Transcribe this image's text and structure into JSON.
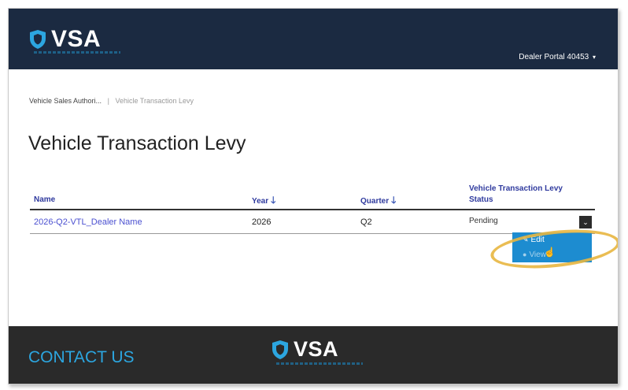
{
  "header": {
    "brand": "VSA",
    "portal_label": "Dealer Portal 40453",
    "caret": "▾"
  },
  "breadcrumb": {
    "root": "Vehicle Sales Authori...",
    "separator": "|",
    "current": "Vehicle Transaction Levy"
  },
  "page": {
    "title": "Vehicle Transaction Levy"
  },
  "table": {
    "columns": {
      "name": "Name",
      "year": "Year",
      "quarter": "Quarter",
      "status": "Vehicle Transaction Levy Status"
    },
    "sort_arrow": "🡓",
    "rows": [
      {
        "name": "2026-Q2-VTL_Dealer Name",
        "year": "2026",
        "quarter": "Q2",
        "status": "Pending"
      }
    ],
    "row_menu_icon": "⌄"
  },
  "dropdown": {
    "items": [
      {
        "label": "Edit",
        "icon": "edit-icon"
      },
      {
        "label": "View",
        "icon": "view-icon"
      }
    ]
  },
  "footer": {
    "contact": "CONTACT US",
    "brand": "VSA"
  },
  "colors": {
    "header_bg": "#1b2a41",
    "footer_bg": "#2a2a2a",
    "accent_blue": "#2ca6e0",
    "link": "#4a4fd0",
    "dropdown_bg": "#1d8cd0",
    "highlight": "#e8b640"
  }
}
